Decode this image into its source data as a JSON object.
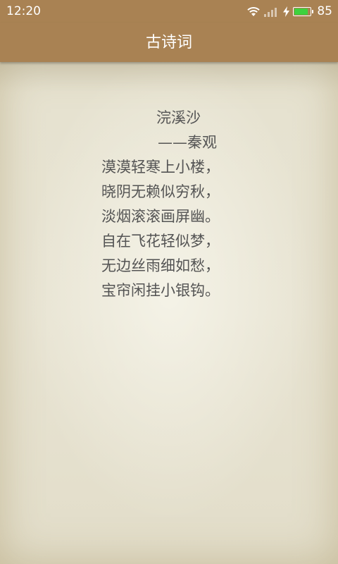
{
  "status_bar": {
    "time": "12:20",
    "battery_level": "85",
    "icons": [
      "wifi-icon",
      "signal-icon",
      "charging-icon",
      "battery-icon"
    ],
    "battery_fraction": 0.85
  },
  "app_bar": {
    "title": "古诗词"
  },
  "poem": {
    "title": "浣溪沙",
    "author": "——秦观",
    "lines": [
      "漠漠轻寒上小楼，",
      "晓阴无赖似穷秋，",
      "淡烟滚滚画屏幽。",
      "自在飞花轻似梦，",
      "无边丝雨细如愁，",
      "宝帘闲挂小银钩。"
    ]
  },
  "colors": {
    "app_bar": "#a98253",
    "paper": "#e6e2d0",
    "text": "#545454",
    "battery": "#3ed13e"
  }
}
